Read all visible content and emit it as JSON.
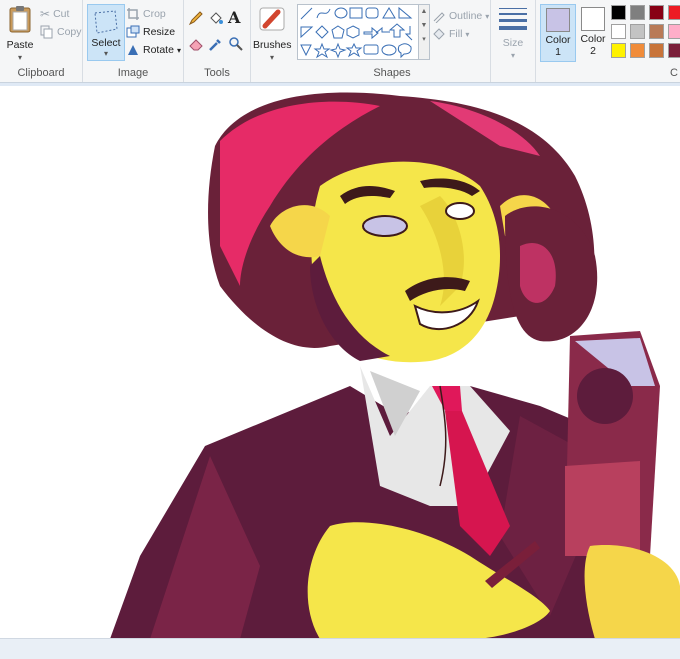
{
  "clipboard": {
    "paste_label": "Paste",
    "cut_label": "Cut",
    "copy_label": "Copy",
    "group_label": "Clipboard"
  },
  "image": {
    "select_label": "Select",
    "crop_label": "Crop",
    "resize_label": "Resize",
    "rotate_label": "Rotate",
    "group_label": "Image"
  },
  "tools": {
    "group_label": "Tools",
    "items": [
      "pencil-icon",
      "fill-bucket-icon",
      "text-icon",
      "eraser-icon",
      "color-picker-icon",
      "magnifier-icon"
    ]
  },
  "brushes": {
    "label": "Brushes"
  },
  "shapes": {
    "group_label": "Shapes",
    "outline_label": "Outline",
    "fill_label": "Fill"
  },
  "size": {
    "label": "Size"
  },
  "colors": {
    "color1_label": "Color",
    "color1_num": "1",
    "color2_label": "Color",
    "color2_num": "2",
    "color1_value": "#c8c3e6",
    "color2_value": "#ffffff",
    "group_label": "C"
  },
  "palette": [
    [
      "#000000",
      "#7f7f7f",
      "#880015",
      "#ed1c24"
    ],
    [
      "#ffffff",
      "#c3c3c3",
      "#b97a57",
      "#ffaec9"
    ],
    [
      "#fff200",
      "#f08c3a",
      "#c8743a",
      "#7a1f3a"
    ]
  ]
}
